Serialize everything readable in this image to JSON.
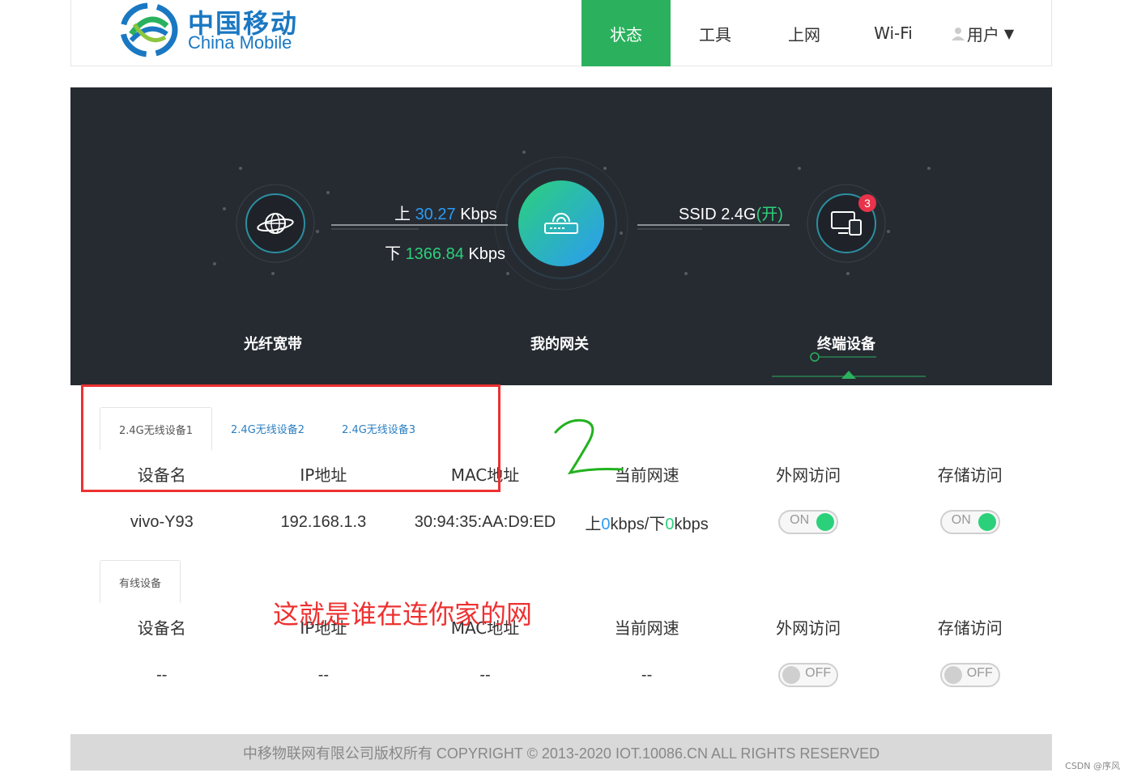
{
  "header": {
    "logo_zh": "中国移动",
    "logo_en": "China Mobile",
    "nav": [
      {
        "label": "状态",
        "active": true
      },
      {
        "label": "工具",
        "active": false
      },
      {
        "label": "上网",
        "active": false
      },
      {
        "label": "Wi-Fi",
        "active": false
      },
      {
        "label": "用户",
        "active": false,
        "dropdown": true
      }
    ]
  },
  "hero": {
    "fiber_label": "光纤宽带",
    "gateway_label": "我的网关",
    "terminal_label": "终端设备",
    "up_prefix": "上",
    "up_value": "30.27",
    "up_unit": "Kbps",
    "down_prefix": "下",
    "down_value": "1366.84",
    "down_unit": "Kbps",
    "ssid_text": "SSID 2.4G",
    "ssid_state": "(开)",
    "device_count": "3",
    "colors": {
      "accent_green": "#2bd17a",
      "accent_blue": "#2b9bf4",
      "bg": "#262b32",
      "badge": "#e8334a"
    }
  },
  "wireless": {
    "tabs": [
      "2.4G无线设备1",
      "2.4G无线设备2",
      "2.4G无线设备3"
    ],
    "columns": [
      "设备名",
      "IP地址",
      "MAC地址",
      "当前网速",
      "外网访问",
      "存储访问"
    ],
    "rows": [
      {
        "name": "vivo-Y93",
        "ip": "192.168.1.3",
        "mac": "30:94:35:AA:D9:ED",
        "speed_up_prefix": "上",
        "speed_up": "0",
        "speed_mid": "kbps/下",
        "speed_down": "0",
        "speed_unit": "kbps",
        "internet": "ON",
        "storage": "ON"
      }
    ]
  },
  "wired": {
    "tab": "有线设备",
    "columns": [
      "设备名",
      "IP地址",
      "MAC地址",
      "当前网速",
      "外网访问",
      "存储访问"
    ],
    "rows": [
      {
        "name": "--",
        "ip": "--",
        "mac": "--",
        "speed": "--",
        "internet": "OFF",
        "storage": "OFF"
      }
    ]
  },
  "annotation": {
    "handwritten_number": "2",
    "note": "这就是谁在连你家的网"
  },
  "footer": {
    "text": "中移物联网有限公司版权所有 COPYRIGHT © 2013-2020 IOT.10086.CN ALL RIGHTS RESERVED"
  },
  "watermark": "CSDN @序风"
}
